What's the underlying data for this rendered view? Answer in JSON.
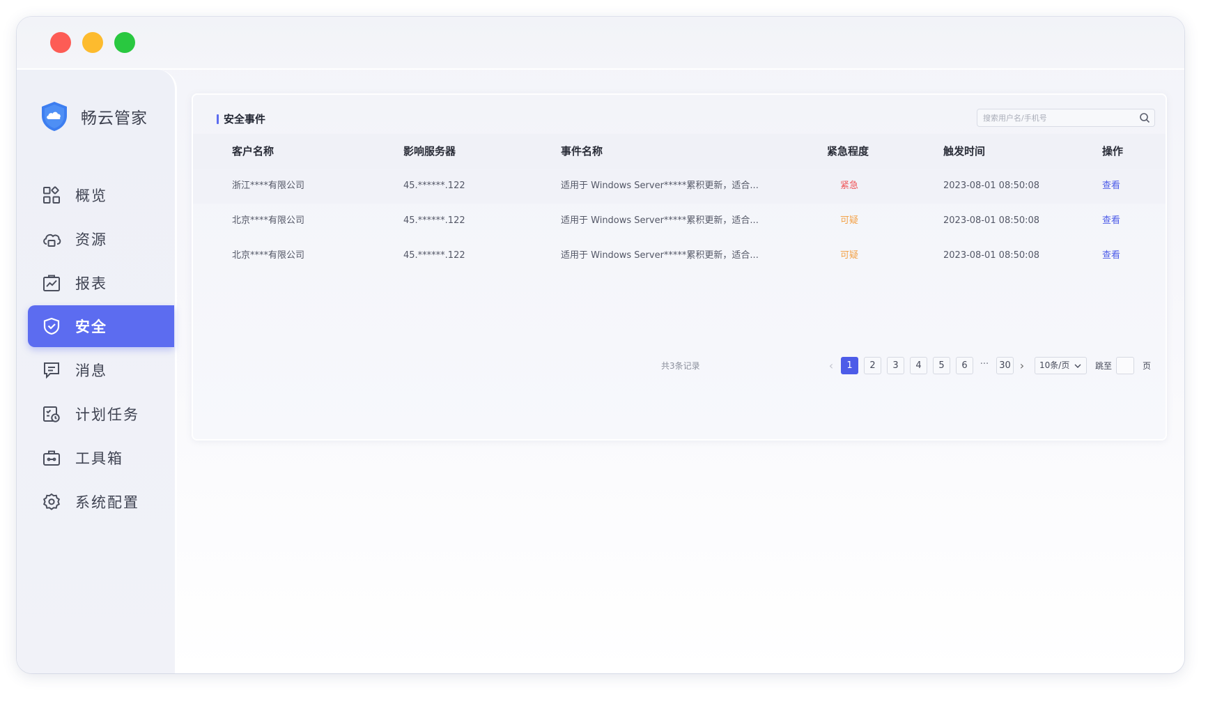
{
  "app": {
    "name": "畅云管家"
  },
  "sidebar": {
    "items": [
      {
        "label": "概览",
        "icon": "overview-grid-icon"
      },
      {
        "label": "资源",
        "icon": "cloud-resource-icon"
      },
      {
        "label": "报表",
        "icon": "report-chart-icon"
      },
      {
        "label": "安全",
        "icon": "shield-check-icon",
        "active": true
      },
      {
        "label": "消息",
        "icon": "message-icon"
      },
      {
        "label": "计划任务",
        "icon": "schedule-task-icon"
      },
      {
        "label": "工具箱",
        "icon": "toolbox-icon"
      },
      {
        "label": "系统配置",
        "icon": "gear-icon"
      }
    ]
  },
  "panel": {
    "title": "安全事件",
    "search_placeholder": "搜索用户名/手机号"
  },
  "table": {
    "columns": [
      "客户名称",
      "影响服务器",
      "事件名称",
      "紧急程度",
      "触发时间",
      "操作"
    ],
    "rows": [
      {
        "customer": "浙江****有限公司",
        "server": "45.******.122",
        "event": "适用于 Windows Server*****累积更新，适合...",
        "level": "紧急",
        "time": "2023-08-01 08:50:08",
        "action": "查看"
      },
      {
        "customer": "北京****有限公司",
        "server": "45.******.122",
        "event": "适用于 Windows Server*****累积更新，适合...",
        "level": "可疑",
        "time": "2023-08-01 08:50:08",
        "action": "查看"
      },
      {
        "customer": "北京****有限公司",
        "server": "45.******.122",
        "event": "适用于 Windows Server*****累积更新，适合...",
        "level": "可疑",
        "time": "2023-08-01 08:50:08",
        "action": "查看"
      }
    ]
  },
  "pagination": {
    "total": "共3条记录",
    "pages": [
      "1",
      "2",
      "3",
      "4",
      "5",
      "6"
    ],
    "ellipsis": "···",
    "last_page": "30",
    "current": "1",
    "page_size": "10条/页",
    "jump_label": "跳至",
    "page_suffix": "页"
  },
  "colors": {
    "accent": "#5c6cf0",
    "urgent": "#f0575a",
    "suspect": "#f3a34a",
    "link": "#4d5ce8"
  }
}
